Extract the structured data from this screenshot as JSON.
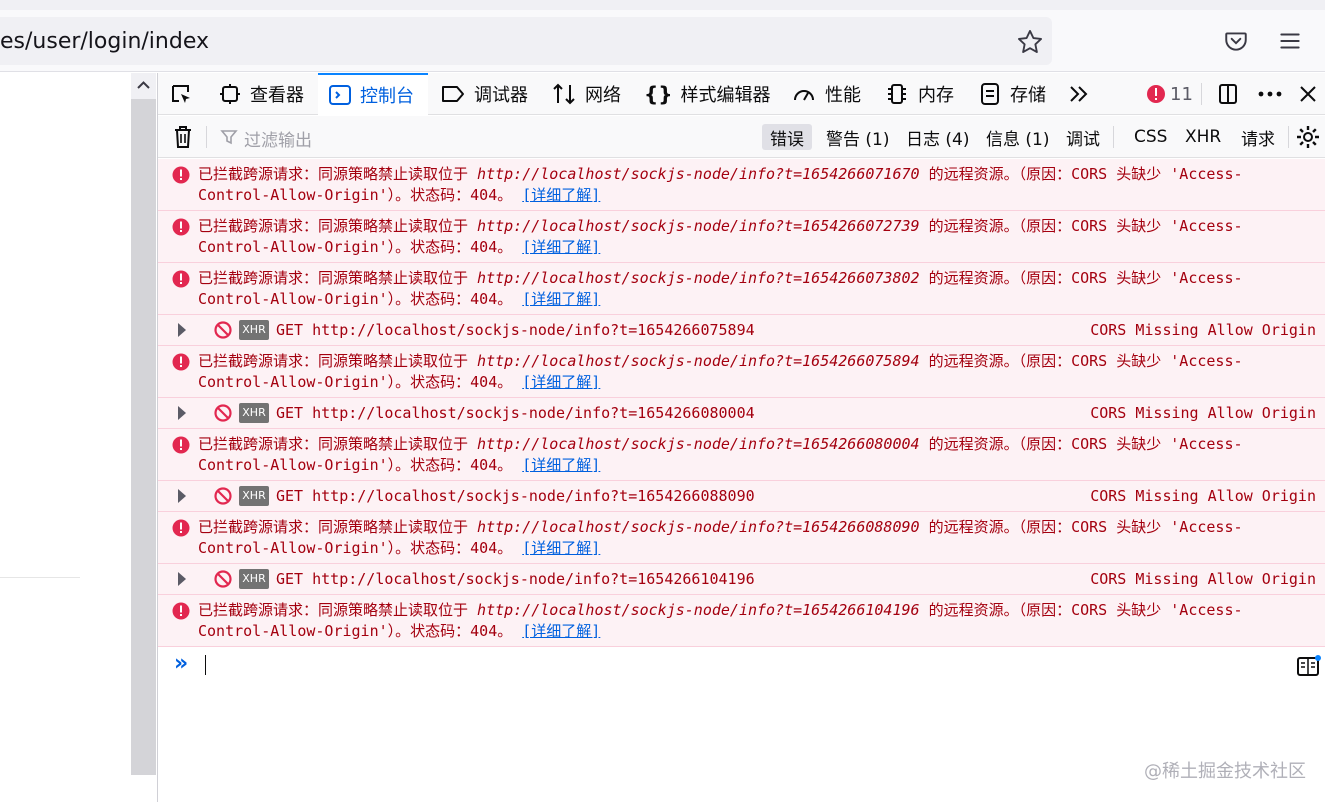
{
  "browser": {
    "url": "es/user/login/index",
    "icons": [
      "star-icon",
      "pocket-icon",
      "hamburger-menu-icon"
    ]
  },
  "devtools": {
    "tabs": [
      {
        "label": "查看器",
        "icon": "inspector-icon"
      },
      {
        "label": "控制台",
        "icon": "console-icon",
        "active": true
      },
      {
        "label": "调试器",
        "icon": "debugger-icon"
      },
      {
        "label": "网络",
        "icon": "network-icon"
      },
      {
        "label": "样式编辑器",
        "icon": "style-editor-icon"
      },
      {
        "label": "性能",
        "icon": "performance-icon"
      },
      {
        "label": "内存",
        "icon": "memory-icon"
      },
      {
        "label": "存储",
        "icon": "storage-icon"
      }
    ],
    "error_count": "11",
    "filter_placeholder": "过滤输出",
    "filters": {
      "errors": "错误",
      "warnings": "警告 (1)",
      "logs": "日志 (4)",
      "info": "信息 (1)",
      "debug": "调试",
      "css": "CSS",
      "xhr": "XHR",
      "requests": "请求"
    }
  },
  "console": {
    "text": {
      "blocked_prefix": "已拦截跨源请求：同源策略禁止读取位于 ",
      "blocked_suffix": " 的远程资源。（原因：CORS 头缺少 'Access-",
      "blocked_line2": "Control-Allow-Origin'）。状态码：404。",
      "learn_more": "[详细了解]",
      "xhr_badge": "XHR",
      "net_reason": "CORS Missing Allow Origin"
    },
    "messages": [
      {
        "type": "error",
        "url": "http://localhost/sockjs-node/info?t=1654266071670"
      },
      {
        "type": "error",
        "url": "http://localhost/sockjs-node/info?t=1654266072739"
      },
      {
        "type": "error",
        "url": "http://localhost/sockjs-node/info?t=1654266073802"
      },
      {
        "type": "network",
        "text": "GET http://localhost/sockjs-node/info?t=1654266075894"
      },
      {
        "type": "error",
        "url": "http://localhost/sockjs-node/info?t=1654266075894"
      },
      {
        "type": "network",
        "text": "GET http://localhost/sockjs-node/info?t=1654266080004"
      },
      {
        "type": "error",
        "url": "http://localhost/sockjs-node/info?t=1654266080004"
      },
      {
        "type": "network",
        "text": "GET http://localhost/sockjs-node/info?t=1654266088090"
      },
      {
        "type": "error",
        "url": "http://localhost/sockjs-node/info?t=1654266088090"
      },
      {
        "type": "network",
        "text": "GET http://localhost/sockjs-node/info?t=1654266104196"
      },
      {
        "type": "error",
        "url": "http://localhost/sockjs-node/info?t=1654266104196"
      }
    ],
    "prompt": "»"
  },
  "watermark": "@稀土掘金技术社区",
  "colors": {
    "accent": "#0060df",
    "error_text": "#a4000f",
    "error_bg": "#fdf2f5",
    "error_icon": "#e22850"
  }
}
